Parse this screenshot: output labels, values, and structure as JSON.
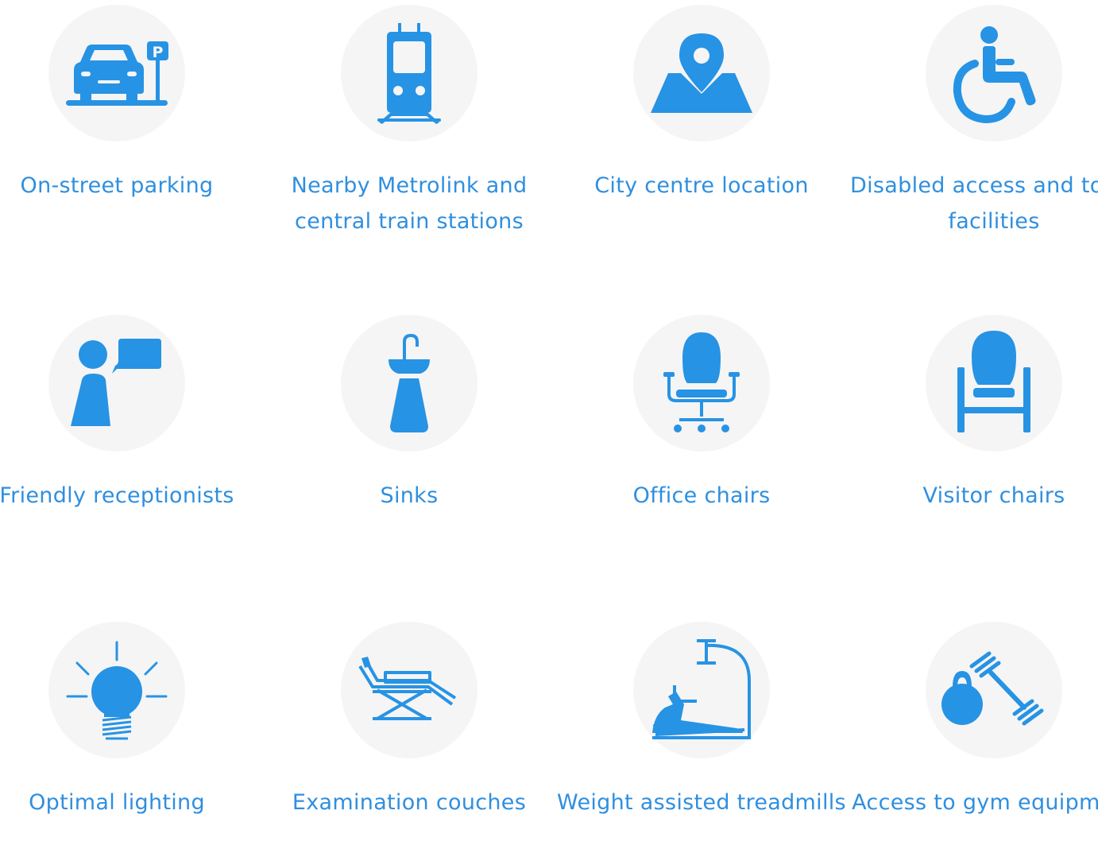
{
  "colors": {
    "accent": "#2793e4",
    "label": "#2f8fdf",
    "circle": "#f5f5f5"
  },
  "features": [
    {
      "icon": "car-parking-icon",
      "label": "On-street parking"
    },
    {
      "icon": "train-icon",
      "label": "Nearby Metrolink and central train stations"
    },
    {
      "icon": "map-pin-icon",
      "label": "City centre location"
    },
    {
      "icon": "wheelchair-icon",
      "label": "Disabled access and toilet facilities"
    },
    {
      "icon": "receptionist-icon",
      "label": "Friendly receptionists"
    },
    {
      "icon": "sink-icon",
      "label": "Sinks"
    },
    {
      "icon": "office-chair-icon",
      "label": "Office chairs"
    },
    {
      "icon": "visitor-chair-icon",
      "label": "Visitor chairs"
    },
    {
      "icon": "light-bulb-icon",
      "label": "Optimal lighting"
    },
    {
      "icon": "examination-couch-icon",
      "label": "Examination couches"
    },
    {
      "icon": "treadmill-icon",
      "label": "Weight assisted treadmills"
    },
    {
      "icon": "gym-equipment-icon",
      "label": "Access to gym equipment"
    }
  ]
}
